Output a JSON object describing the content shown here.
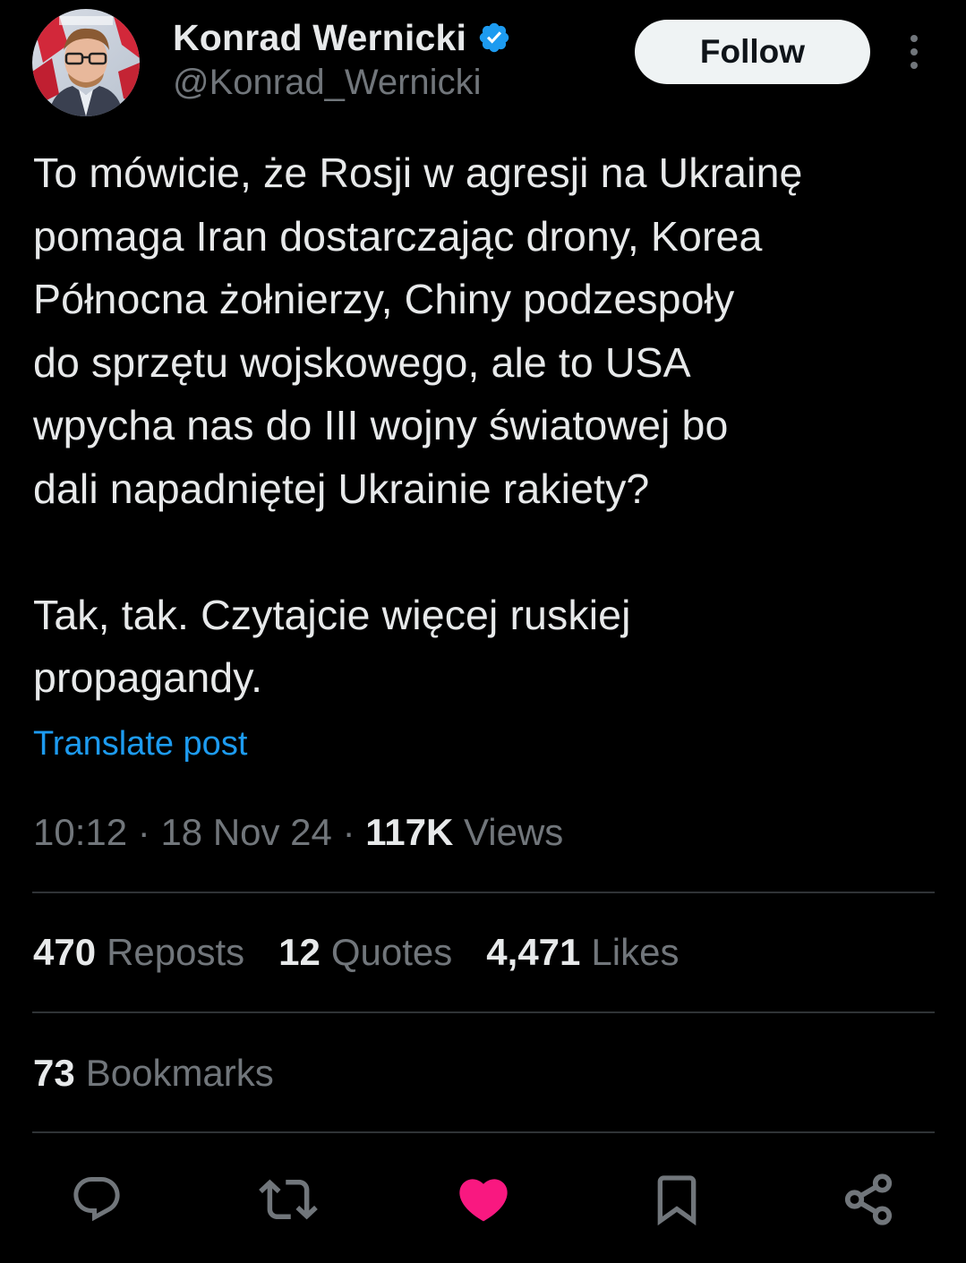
{
  "author": {
    "display_name": "Konrad Wernicki",
    "handle": "@Konrad_Wernicki",
    "verified_icon": "verified-badge-icon",
    "avatar": "avatar"
  },
  "header": {
    "follow_label": "Follow",
    "more_icon": "more-vertical-icon"
  },
  "tweet": {
    "text": "To mówicie, że Rosji w agresji na Ukrainę\npomaga Iran dostarczając drony, Korea\nPółnocna żołnierzy, Chiny podzespoły\ndo sprzętu wojskowego, ale to USA\nwpycha nas do III wojny światowej bo\ndali napadniętej Ukrainie rakiety?\n\nTak, tak. Czytajcie więcej ruskiej\npropagandy.",
    "translate_label": "Translate post"
  },
  "meta": {
    "time": "10:12",
    "sep1": " · ",
    "date": "18 Nov 24",
    "sep2": " · ",
    "views_count": "117K",
    "views_label": " Views"
  },
  "stats": {
    "reposts_count": "470",
    "reposts_label": "Reposts",
    "quotes_count": "12",
    "quotes_label": "Quotes",
    "likes_count": "4,471",
    "likes_label": "Likes",
    "bookmarks_count": "73",
    "bookmarks_label": "Bookmarks"
  },
  "actions": {
    "reply_icon": "reply-icon",
    "repost_icon": "repost-icon",
    "like_icon": "heart-icon",
    "bookmark_icon": "bookmark-icon",
    "share_icon": "share-icon"
  },
  "colors": {
    "background": "#000000",
    "text": "#e7e9ea",
    "secondary": "#71767b",
    "link": "#1d9bf0",
    "like": "#f91880",
    "verified": "#1d9bf0",
    "divider": "#2f3336"
  }
}
